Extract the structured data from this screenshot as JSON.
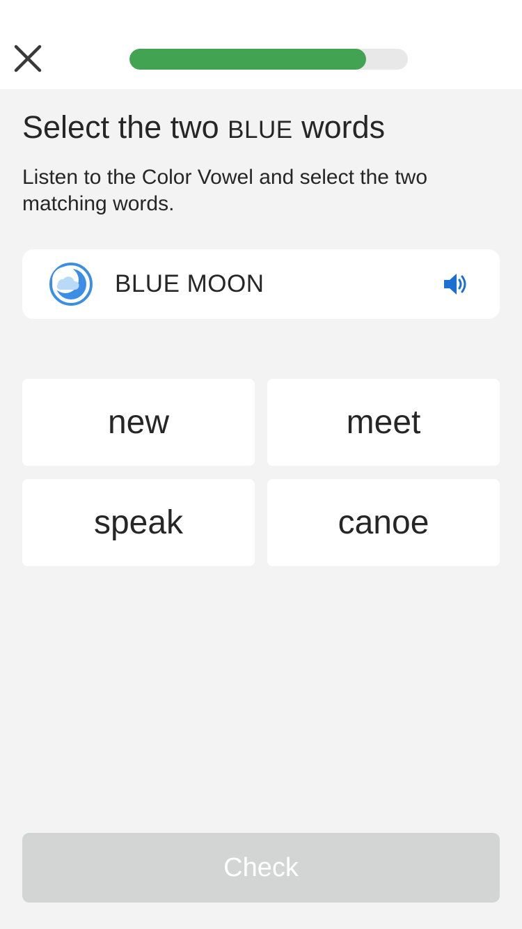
{
  "header": {
    "close_icon": "close-icon",
    "progress": 0.85,
    "progress_color": "#42a452",
    "progress_track_color": "#e8e8e8"
  },
  "prompt": {
    "title_prefix": "Select the two ",
    "title_color_word": "BLUE",
    "title_suffix": " words",
    "subtitle": "Listen to the Color Vowel and select the two matching words."
  },
  "color_card": {
    "icon": "blue-moon-icon",
    "label": "BLUE MOON",
    "speaker_icon": "speaker-icon",
    "accent_color": "#3b8ee6"
  },
  "words": [
    {
      "label": "new"
    },
    {
      "label": "meet"
    },
    {
      "label": "speak"
    },
    {
      "label": "canoe"
    }
  ],
  "footer": {
    "check_label": "Check",
    "check_color": "#d3d4d4"
  }
}
